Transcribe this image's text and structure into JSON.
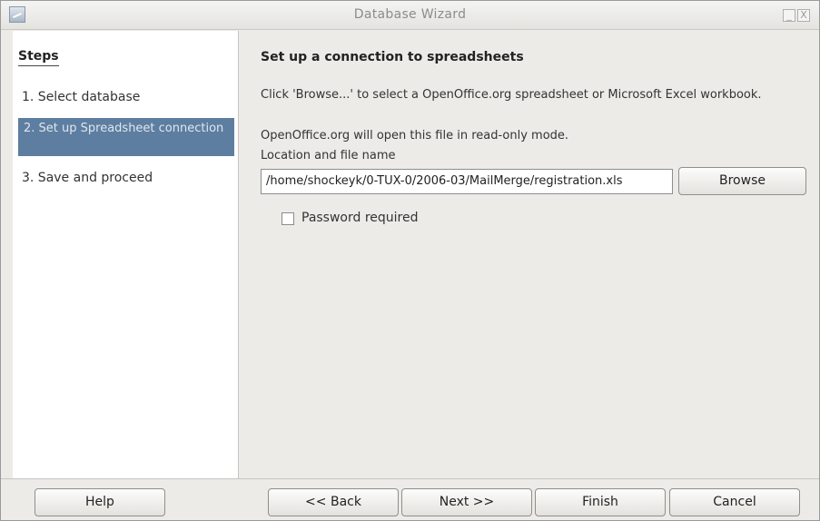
{
  "window": {
    "title": "Database Wizard",
    "minimize_glyph": "_",
    "close_glyph": "X"
  },
  "steps": {
    "title": "Steps",
    "items": [
      {
        "label": "1. Select database",
        "active": false
      },
      {
        "label": "2. Set up Spreadsheet connection",
        "active": true
      },
      {
        "label": "3. Save and proceed",
        "active": false
      }
    ]
  },
  "content": {
    "title": "Set up a connection to spreadsheets",
    "instruction": "Click 'Browse...' to select a OpenOffice.org spreadsheet or Microsoft Excel workbook.",
    "note": "OpenOffice.org will open this file in read-only mode.",
    "location_label": "Location and file name",
    "path_value": "/home/shockeyk/0-TUX-0/2006-03/MailMerge/registration.xls",
    "browse_label": "Browse",
    "password_label": "Password required",
    "password_checked": false
  },
  "buttons": {
    "help": "Help",
    "back": "<< Back",
    "next": "Next >>",
    "finish": "Finish",
    "cancel": "Cancel"
  }
}
